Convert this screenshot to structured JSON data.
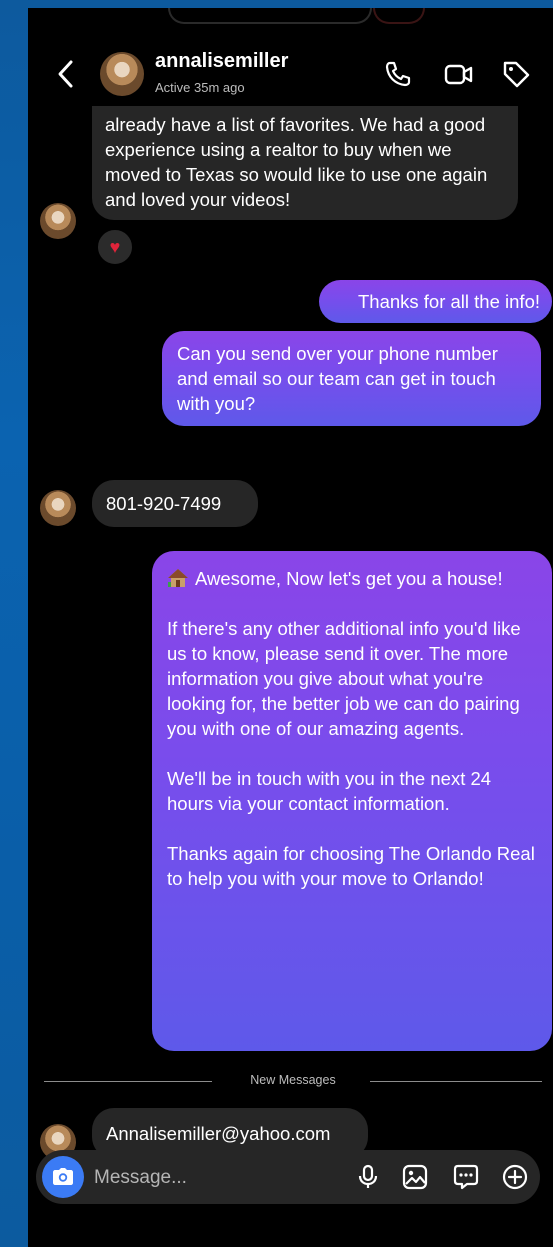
{
  "header": {
    "username": "annalisemiller",
    "status": "Active 35m ago"
  },
  "messages": [
    {
      "text": "already have a list of favorites. We had a good experience using a realtor to buy when we moved to Texas so would like to use one again and loved your videos!"
    },
    {
      "text": "Thanks for all the info!"
    },
    {
      "text": "Can you send over your phone number and email so our team can get in touch with you?"
    },
    {
      "text": "801-920-7499"
    },
    {
      "p1": "Awesome, Now let's get you a house!",
      "p2": "If there's any other additional info you'd like us to know, please send it over. The more information you give about what you're looking for, the better job we can do pairing you with one of our amazing agents.",
      "p3": "We'll be in touch with you in the next 24 hours via your contact information.",
      "p4": "Thanks again for choosing The Orlando Real to help you with your move to Orlando!"
    },
    {
      "text": "Annalisemiller@yahoo.com"
    }
  ],
  "reaction": {
    "emoji": "♥"
  },
  "divider": {
    "label": "New Messages"
  },
  "composer": {
    "placeholder": "Message..."
  },
  "icons": {
    "back": "chevron-left-icon",
    "call": "phone-icon",
    "video": "video-camera-icon",
    "tag": "tag-icon",
    "camera": "camera-icon",
    "mic": "microphone-icon",
    "gallery": "image-icon",
    "sticker": "chat-bubble-icon",
    "add": "plus-circle-icon"
  },
  "colors": {
    "outgoing_top": "#8a45e8",
    "outgoing_bottom": "#5e59ea",
    "incoming": "#262626",
    "camera_button": "#3b7bf5",
    "background": "#0b63b0"
  }
}
